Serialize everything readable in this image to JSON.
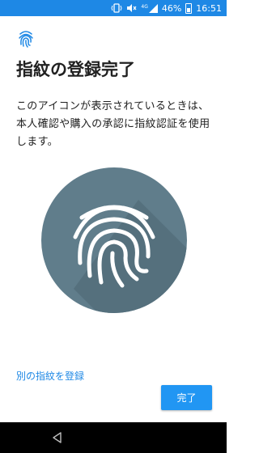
{
  "status_bar": {
    "network_label": "4G",
    "battery": "46%",
    "time": "16:51",
    "icons": [
      "vibrate-icon",
      "mute-icon",
      "signal-icon",
      "battery-icon"
    ]
  },
  "page": {
    "title": "指紋の登録完了",
    "description": "このアイコンが表示されているときは、本人確認や購入の承認に指紋認証を使用します。"
  },
  "actions": {
    "add_another_label": "別の指紋を登録",
    "done_label": "完了"
  },
  "colors": {
    "accent": "#1e88e5",
    "button": "#2196f3",
    "circle": "#607d8b"
  },
  "nav_bar": {
    "icons": [
      "back-icon"
    ]
  }
}
